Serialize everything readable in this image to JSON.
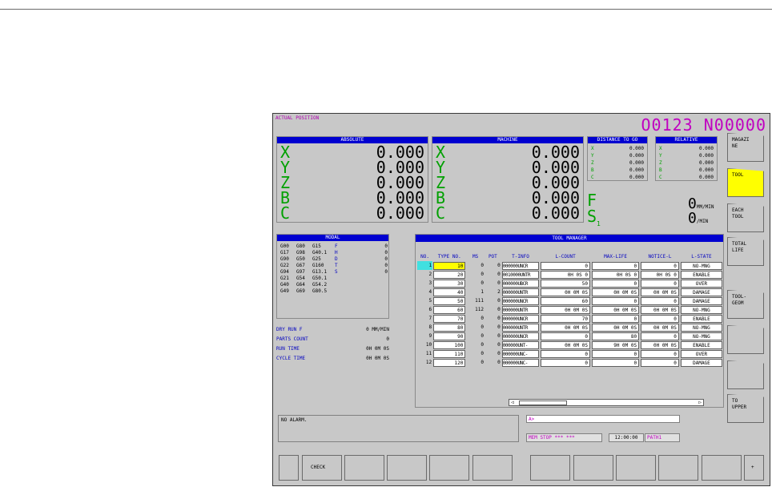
{
  "header": {
    "label": "ACTUAL POSITION",
    "program": "O0123 N00000"
  },
  "absolute": {
    "title": "ABSOLUTE",
    "rows": [
      {
        "axis": "X",
        "value": "0.000"
      },
      {
        "axis": "Y",
        "value": "0.000"
      },
      {
        "axis": "Z",
        "value": "0.000"
      },
      {
        "axis": "B",
        "value": "0.000"
      },
      {
        "axis": "C",
        "value": "0.000"
      }
    ]
  },
  "machine": {
    "title": "MACHINE",
    "rows": [
      {
        "axis": "X",
        "value": "0.000"
      },
      {
        "axis": "Y",
        "value": "0.000"
      },
      {
        "axis": "Z",
        "value": "0.000"
      },
      {
        "axis": "B",
        "value": "0.000"
      },
      {
        "axis": "C",
        "value": "0.000"
      }
    ]
  },
  "distance": {
    "title": "DISTANCE TO GO",
    "rows": [
      {
        "axis": "X",
        "value": "0.000"
      },
      {
        "axis": "Y",
        "value": "0.000"
      },
      {
        "axis": "Z",
        "value": "0.000"
      },
      {
        "axis": "B",
        "value": "0.000"
      },
      {
        "axis": "C",
        "value": "0.000"
      }
    ]
  },
  "relative": {
    "title": "RELATIVE",
    "rows": [
      {
        "axis": "X",
        "value": "0.000"
      },
      {
        "axis": "Y",
        "value": "0.000"
      },
      {
        "axis": "Z",
        "value": "0.000"
      },
      {
        "axis": "B",
        "value": "0.000"
      },
      {
        "axis": "C",
        "value": "0.000"
      }
    ]
  },
  "feed": {
    "f_label": "F",
    "f_value": "0",
    "f_unit": "MM/MIN",
    "s_label": "S",
    "s_sub": "1",
    "s_value": "0",
    "s_unit": "/MIN"
  },
  "modal": {
    "title": "MODAL",
    "rows": [
      {
        "c1": "G00",
        "c2": "G80",
        "c3": "G15",
        "l": "F",
        "v": "0"
      },
      {
        "c1": "G17",
        "c2": "G98",
        "c3": "G40.1",
        "l": "H",
        "v": "0"
      },
      {
        "c1": "G90",
        "c2": "G50",
        "c3": "G25",
        "l": "D",
        "v": "0"
      },
      {
        "c1": "G22",
        "c2": "G67",
        "c3": "G160",
        "l": "T",
        "v": "0"
      },
      {
        "c1": "G94",
        "c2": "G97",
        "c3": "G13.1",
        "l": "S",
        "v": "0"
      },
      {
        "c1": "G21",
        "c2": "G54",
        "c3": "G50.1",
        "l": "",
        "v": ""
      },
      {
        "c1": "G40",
        "c2": "G64",
        "c3": "G54.2",
        "l": "",
        "v": ""
      },
      {
        "c1": "G49",
        "c2": "G69",
        "c3": "G80.5",
        "l": "",
        "v": ""
      }
    ]
  },
  "info": [
    {
      "label": "DRY RUN F",
      "value": "0 MM/MIN"
    },
    {
      "label": "PARTS COUNT",
      "value": "0"
    },
    {
      "label": "RUN TIME",
      "value": "0H 0M 0S"
    },
    {
      "label": "CYCLE TIME",
      "value": "0H 0M 0S"
    }
  ],
  "tool_manager": {
    "title": "TOOL MANAGER",
    "headers": [
      "NO.",
      "TYPE NO.",
      "MS",
      "POT",
      "T-INFO",
      "L-COUNT",
      "MAX-LIFE",
      "NOTICE-L",
      "L-STATE"
    ],
    "rows": [
      {
        "no": "1",
        "type": "10",
        "ms": "0",
        "pot": "0",
        "tinfo": "000000UNCR",
        "lc": "0",
        "ml": "0",
        "nl": "0",
        "ls": "NO-MNG"
      },
      {
        "no": "2",
        "type": "20",
        "ms": "0",
        "pot": "0",
        "tinfo": "0010000UNTR",
        "lc": "0H 0S 0",
        "ml": "0H 0S 0",
        "nl": "0H 0S 0",
        "ls": "ENABLE"
      },
      {
        "no": "3",
        "type": "30",
        "ms": "0",
        "pot": "0",
        "tinfo": "000000UBCR",
        "lc": "50",
        "ml": "0",
        "nl": "0",
        "ls": "OVER"
      },
      {
        "no": "4",
        "type": "40",
        "ms": "1",
        "pot": "2",
        "tinfo": "000000UNTR",
        "lc": "0H 0M 0S",
        "ml": "0H 0M 0S",
        "nl": "0H 0M 0S",
        "ls": "DAMAGE"
      },
      {
        "no": "5",
        "type": "50",
        "ms": "111",
        "pot": "0",
        "tinfo": "000000UNCR",
        "lc": "60",
        "ml": "0",
        "nl": "0",
        "ls": "DAMAGE"
      },
      {
        "no": "6",
        "type": "60",
        "ms": "112",
        "pot": "0",
        "tinfo": "000000UNTR",
        "lc": "0H 0M 0S",
        "ml": "0H 0M 0S",
        "nl": "0H 0M 0S",
        "ls": "NO-MNG"
      },
      {
        "no": "7",
        "type": "70",
        "ms": "0",
        "pot": "0",
        "tinfo": "000000UNCR",
        "lc": "70",
        "ml": "0",
        "nl": "0",
        "ls": "ENABLE"
      },
      {
        "no": "8",
        "type": "80",
        "ms": "0",
        "pot": "0",
        "tinfo": "000000UNTR",
        "lc": "0H 0M 0S",
        "ml": "0H 0M 0S",
        "nl": "0H 0M 0S",
        "ls": "NO-MNG"
      },
      {
        "no": "9",
        "type": "90",
        "ms": "0",
        "pot": "0",
        "tinfo": "000000UNCR",
        "lc": "0",
        "ml": "80",
        "nl": "0",
        "ls": "NO-MNG"
      },
      {
        "no": "10",
        "type": "100",
        "ms": "0",
        "pot": "0",
        "tinfo": "000000UNT-",
        "lc": "0H 0M 0S",
        "ml": "9H 0M 0S",
        "nl": "0H 0M 0S",
        "ls": "ENABLE"
      },
      {
        "no": "11",
        "type": "110",
        "ms": "0",
        "pot": "0",
        "tinfo": "000000UNC-",
        "lc": "0",
        "ml": "0",
        "nl": "0",
        "ls": "OVER"
      },
      {
        "no": "12",
        "type": "120",
        "ms": "0",
        "pot": "0",
        "tinfo": "000000UNC-",
        "lc": "0",
        "ml": "0",
        "nl": "0",
        "ls": "DAMAGE"
      }
    ]
  },
  "alarm": "NO ALARM.",
  "command": "A>",
  "status": {
    "mode": "MEM  STOP *** ***",
    "time": "12:00:00",
    "path": "PATH1"
  },
  "soft_keys_vertical": [
    "MAGAZINE",
    "TOOL",
    "EACH TOOL",
    "TOTAL LIFE",
    "",
    "TOOL-GEOM",
    "",
    "",
    "TO UPPER"
  ],
  "soft_keys_horizontal": [
    "",
    "CHECK",
    "",
    "",
    "",
    "",
    "",
    "",
    "",
    "",
    "",
    "",
    ""
  ],
  "soft_key_more": "+",
  "colors": {
    "accent": "#0000d0",
    "active_key": "#ffff00",
    "program": "#c000c0",
    "axis": "#00a000",
    "panel_bg": "#c8c8c8"
  }
}
